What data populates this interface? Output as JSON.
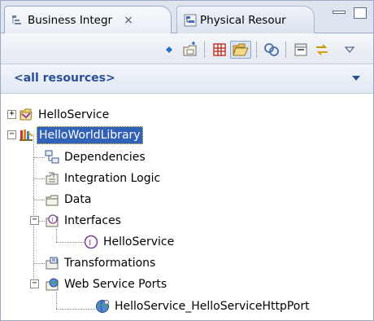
{
  "tabs": [
    {
      "label": "Business Integr",
      "close": "×",
      "icon": "business-integration-view-icon",
      "active": true
    },
    {
      "label": "Physical Resour",
      "icon": "physical-resources-view-icon",
      "active": false
    }
  ],
  "window_buttons": [
    "minimize-icon",
    "maximize-icon"
  ],
  "toolbar": {
    "icons": [
      "dropdown-marker-icon",
      "new-folder-icon",
      "grid-view-icon",
      "open-folder-icon",
      "link-editor-icon",
      "collapse-all-icon",
      "sync-icon",
      "view-menu-icon"
    ]
  },
  "filter": {
    "label": "<all resources>"
  },
  "tree": {
    "items": [
      {
        "label": "HelloService",
        "icon": "module-icon",
        "expander": "+"
      },
      {
        "label": "HelloWorldLibrary",
        "icon": "library-icon",
        "expander": "−",
        "selected": true
      },
      {
        "label": "Dependencies",
        "icon": "dependencies-icon"
      },
      {
        "label": "Integration Logic",
        "icon": "integration-logic-icon"
      },
      {
        "label": "Data",
        "icon": "data-folder-icon"
      },
      {
        "label": "Interfaces",
        "icon": "interfaces-folder-icon",
        "expander": "−"
      },
      {
        "label": "HelloService",
        "icon": "interface-icon"
      },
      {
        "label": "Transformations",
        "icon": "transformations-icon"
      },
      {
        "label": "Web Service Ports",
        "icon": "web-service-ports-icon",
        "expander": "−"
      },
      {
        "label": "HelloService_HelloServiceHttpPort",
        "icon": "web-service-port-icon"
      }
    ]
  },
  "colors": {
    "selection": "#3162b8",
    "filter_text": "#2a4f9a",
    "border": "#9aa9c4"
  }
}
